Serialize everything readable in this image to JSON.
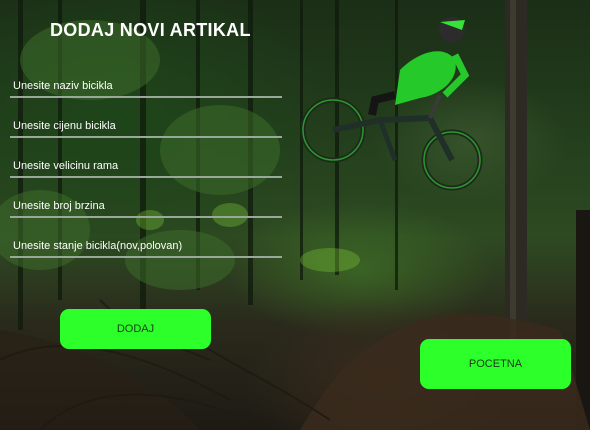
{
  "form": {
    "title": "DODAJ NOVI ARTIKAL",
    "fields": [
      {
        "placeholder": "Unesite naziv bicikla",
        "value": ""
      },
      {
        "placeholder": "Unesite cijenu bicikla",
        "value": ""
      },
      {
        "placeholder": "Unesite velicinu rama",
        "value": ""
      },
      {
        "placeholder": "Unesite broj brzina",
        "value": ""
      },
      {
        "placeholder": "Unesite stanje bicikla(nov,polovan)",
        "value": ""
      }
    ],
    "add_button": "DODAJ",
    "home_button": "POCETNA"
  },
  "colors": {
    "button_bg": "#2dff2a",
    "button_text": "#1a3b1a",
    "field_underline": "#9aa89a",
    "title": "#ffffff"
  }
}
